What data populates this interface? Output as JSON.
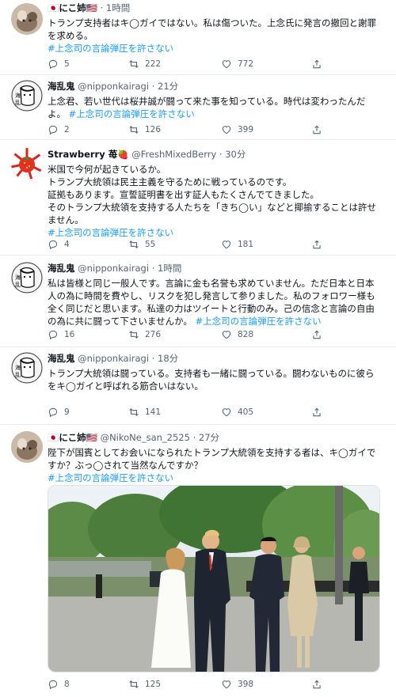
{
  "tweets": [
    {
      "name": "🇯🇵にこ姉🇺🇸",
      "handle": "",
      "time": "1時間",
      "line1": "トランプ支持者はキ◯ガイではない。私は傷ついた。上念氏に発言の撤回と謝罪",
      "line2": "を求める。",
      "hashtag": "#上念司の言論弾圧を許さない",
      "replies": "5",
      "retweets": "222",
      "likes": "772"
    },
    {
      "name": "海乱鬼",
      "handle": "@nipponkairagi",
      "time": "21分",
      "line1": "上念君、若い世代は桜井誠が闘って来た事を知っている。時代は変わったんだ",
      "line2": "よ。",
      "hashtag": "#上念司の言論弾圧を許さない",
      "replies": "2",
      "retweets": "126",
      "likes": "399"
    },
    {
      "name": "Strawberry 苺🍓",
      "handle": "@FreshMixedBerry",
      "time": "30分",
      "line1": "米国で今何が起きているか。",
      "line2": "トランプ大統領は民主主義を守るために戦っているのです。",
      "line3": "証拠もあります。宣誓証明書を出す証人もたくさんでてきました。",
      "line4": "そのトランプ大統領を支持する人たちを「きち◯い」などと揶揄することは許せ",
      "line5": "ません。",
      "hashtag": "#上念司の言論弾圧を許さない",
      "replies": "4",
      "retweets": "55",
      "likes": "181"
    },
    {
      "name": "海乱鬼",
      "handle": "@nipponkairagi",
      "time": "1時間",
      "line1": "私は皆様と同じ一般人です。言論に金も名誉も求めていません。ただ日本と日本",
      "line2": "人の為に時間を費やし、リスクを犯し発言して参りました。私のフォロワー様も",
      "line3": "全く同じだと思います。私達の力はツイートと行動のみ。己の信念と言論の自由",
      "line4": "の為に共に闘って下さいませんか。",
      "hashtag": "#上念司の言論弾圧を許さない",
      "replies": "16",
      "retweets": "276",
      "likes": "828"
    },
    {
      "name": "海乱鬼",
      "handle": "@nipponkairagi",
      "time": "18分",
      "line1": "トランプ大統領は闘っている。支持者も一緒に闘っている。闘わないものに彼ら",
      "line2": "をキ◯ガイと呼ばれる筋合いはない。",
      "replies": "9",
      "retweets": "141",
      "likes": "405"
    },
    {
      "name": "🇯🇵にこ姉🇺🇸",
      "handle": "@NikoNe_san_2525",
      "time": "27分",
      "line1": "陛下が国賓としてお会いになられたトランプ大統領を支持する者は、キ◯ガイで",
      "line2": "すか？ぶっ◯されて当然なんですか？",
      "hashtag": "#上念司の言論弾圧を許さない",
      "replies": "8",
      "retweets": "125",
      "likes": "398"
    }
  ]
}
